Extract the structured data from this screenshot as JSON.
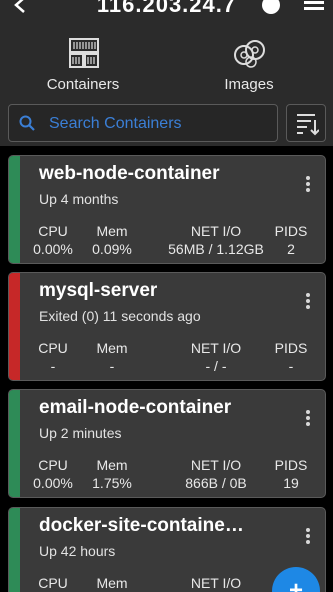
{
  "header": {
    "host": "116.203.24.7",
    "back_icon": "back-arrow-icon",
    "info_icon": "info-icon",
    "menu_icon": "menu-icon"
  },
  "tabs": [
    {
      "label": "Containers",
      "icon": "containers-icon"
    },
    {
      "label": "Images",
      "icon": "images-icon"
    }
  ],
  "search": {
    "placeholder": "Search Containers",
    "icon": "search-icon"
  },
  "sort": {
    "icon": "sort-icon"
  },
  "stat_labels": {
    "cpu": "CPU",
    "mem": "Mem",
    "net": "NET I/O",
    "pids": "PIDS"
  },
  "containers": [
    {
      "name": "web-node-container",
      "status": "Up 4 months",
      "cpu": "0.00%",
      "mem": "0.09%",
      "net": "56MB / 1.12GB",
      "pids": "2",
      "state_color": "#2e8b57"
    },
    {
      "name": "mysql-server",
      "status": "Exited (0) 11 seconds ago",
      "cpu": "-",
      "mem": "-",
      "net": "- / -",
      "pids": "-",
      "state_color": "#c62828"
    },
    {
      "name": "email-node-container",
      "status": "Up 2 minutes",
      "cpu": "0.00%",
      "mem": "1.75%",
      "net": "866B / 0B",
      "pids": "19",
      "state_color": "#2e8b57"
    },
    {
      "name": "docker-site-containe…",
      "status": "Up 42 hours",
      "cpu": "",
      "mem": "",
      "net": "",
      "pids": "",
      "state_color": "#2e8b57"
    }
  ],
  "fab": {
    "label": "+"
  },
  "colors": {
    "accent": "#1e88e5",
    "running": "#2e8b57",
    "exited": "#c62828",
    "background": "#2b2b2b",
    "card": "#3a3a3a"
  }
}
